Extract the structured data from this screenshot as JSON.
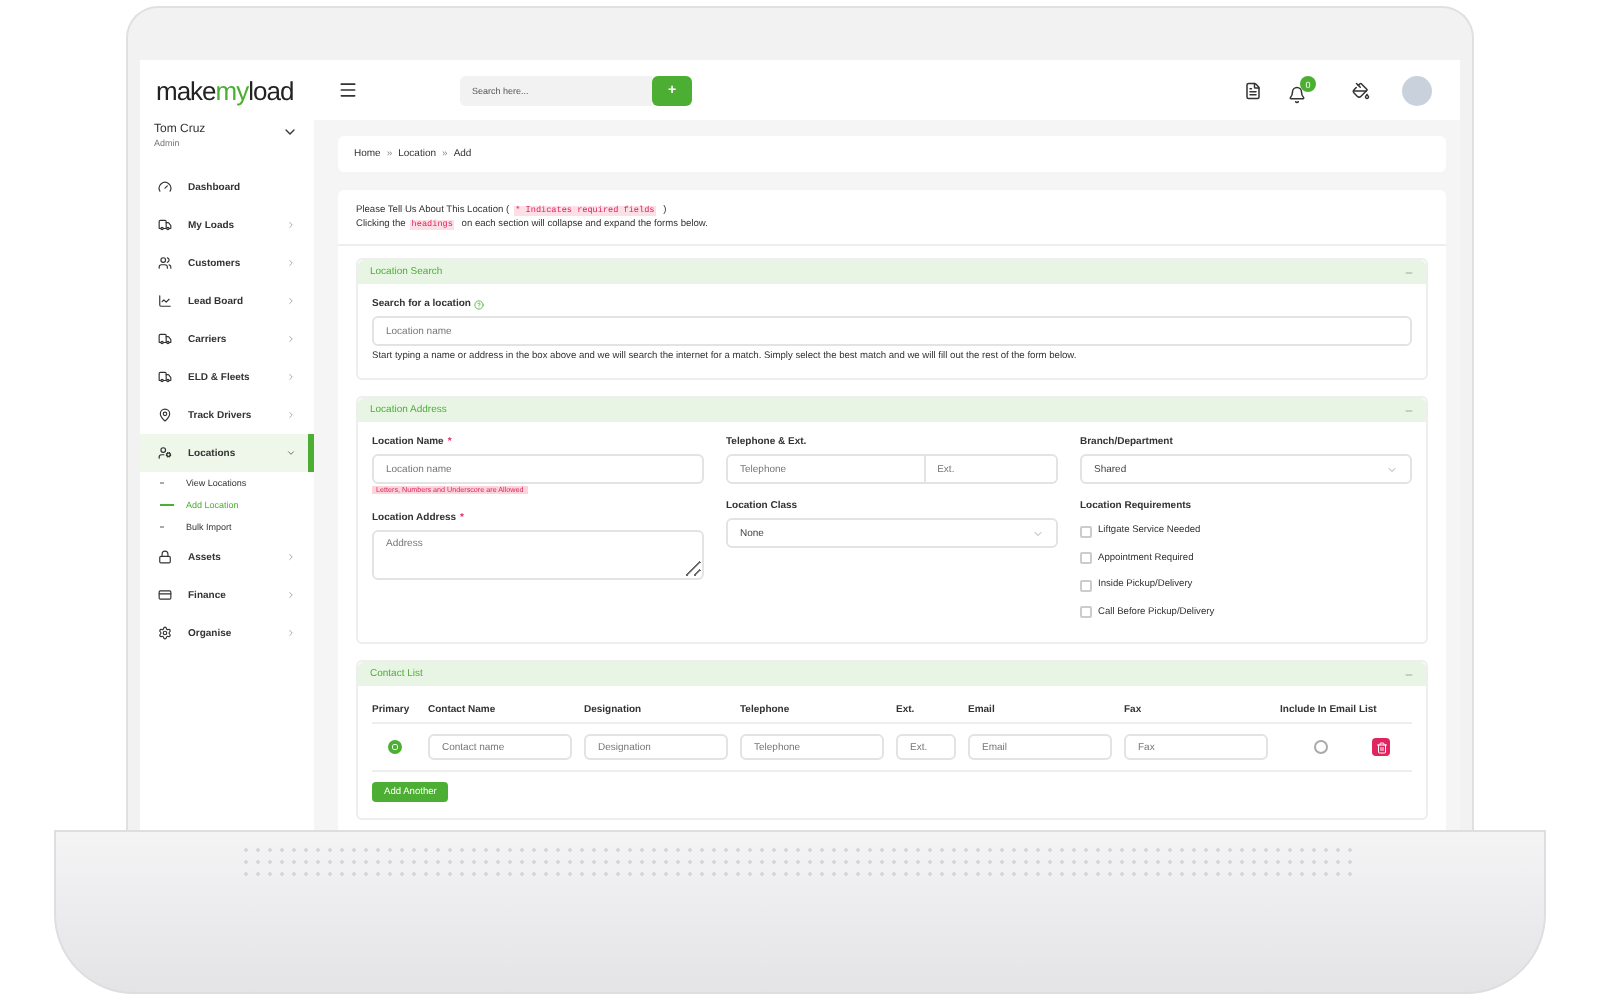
{
  "logo": [
    "make",
    "my",
    "load"
  ],
  "user": {
    "name": "Tom Cruz",
    "role": "Admin"
  },
  "sidebar": {
    "items": [
      {
        "label": "Dashboard",
        "kind": "link",
        "selected": false
      },
      {
        "label": "My Loads",
        "kind": "menu",
        "selected": false,
        "expanded": false
      },
      {
        "label": "Customers",
        "kind": "menu",
        "selected": false,
        "expanded": false
      },
      {
        "label": "Lead Board",
        "kind": "menu",
        "selected": false,
        "expanded": false
      },
      {
        "label": "Carriers",
        "kind": "menu",
        "selected": false,
        "expanded": false
      },
      {
        "label": "ELD & Fleets",
        "kind": "menu",
        "selected": false,
        "expanded": false
      },
      {
        "label": "Track Drivers",
        "kind": "menu",
        "selected": false,
        "expanded": false
      },
      {
        "label": "Locations",
        "kind": "menu",
        "selected": true,
        "expanded": true,
        "children": [
          {
            "label": "View Locations",
            "selected": false
          },
          {
            "label": "Add Location",
            "selected": true
          },
          {
            "label": "Bulk Import",
            "selected": false
          }
        ]
      },
      {
        "label": "Assets",
        "kind": "menu",
        "selected": false,
        "expanded": false
      },
      {
        "label": "Finance",
        "kind": "menu",
        "selected": false,
        "expanded": false
      },
      {
        "label": "Organise",
        "kind": "menu",
        "selected": false,
        "expanded": false
      }
    ]
  },
  "header": {
    "search_placeholder": "Search here...",
    "add_button": "+",
    "notification_count": "0"
  },
  "breadcrumb": {
    "items": [
      "Home",
      "Location",
      "Add"
    ],
    "separator": "»"
  },
  "intro": [
    [
      {
        "kind": "text",
        "text": "Please Tell Us About This Location ("
      },
      {
        "kind": "tag",
        "text": "* Indicates required fields"
      },
      {
        "kind": "text",
        "text": ")"
      }
    ],
    [
      {
        "kind": "text",
        "text": "Clicking the"
      },
      {
        "kind": "tag",
        "text": "headings"
      },
      {
        "kind": "text",
        "text": "on each section will collapse and expand the forms below."
      }
    ]
  ],
  "location_search": {
    "title": "Location Search",
    "expanded": true,
    "label": "Search for a location",
    "placeholder": "Location name",
    "hint": "Start typing a name or address in the box above and we will search the internet for a match. Simply select the best match and we will fill out the rest of the form below."
  },
  "location_address": {
    "title": "Location Address",
    "expanded": true,
    "location_name": {
      "label": "Location Name",
      "required_mark": "*",
      "placeholder": "Location name",
      "error": "Letters, Numbers and Underscore are Allowed"
    },
    "location_address": {
      "label": "Location Address",
      "required_mark": "*",
      "placeholder": "Address"
    },
    "telephone": {
      "label": "Telephone & Ext.",
      "placeholder": "Telephone",
      "ext_placeholder": "Ext."
    },
    "location_class": {
      "label": "Location Class",
      "value": "None"
    },
    "branch": {
      "label": "Branch/Department",
      "value": "Shared"
    },
    "requirements": {
      "label": "Location Requirements",
      "options": [
        {
          "label": "Liftgate Service Needed",
          "checked": false
        },
        {
          "label": "Appointment Required",
          "checked": false
        },
        {
          "label": "Inside Pickup/Delivery",
          "checked": false
        },
        {
          "label": "Call Before Pickup/Delivery",
          "checked": false
        }
      ]
    }
  },
  "contact_list": {
    "title": "Contact List",
    "expanded": true,
    "columns": [
      "Primary",
      "Contact Name",
      "Designation",
      "Telephone",
      "Ext.",
      "Email",
      "Fax",
      "Include In Email List"
    ],
    "rows": [
      {
        "primary": {
          "selected": true
        },
        "placeholders": [
          "Contact name",
          "Designation",
          "Telephone",
          "Ext.",
          "Email",
          "Fax"
        ],
        "include": {
          "selected": false
        }
      }
    ],
    "add_button": "Add Another"
  }
}
